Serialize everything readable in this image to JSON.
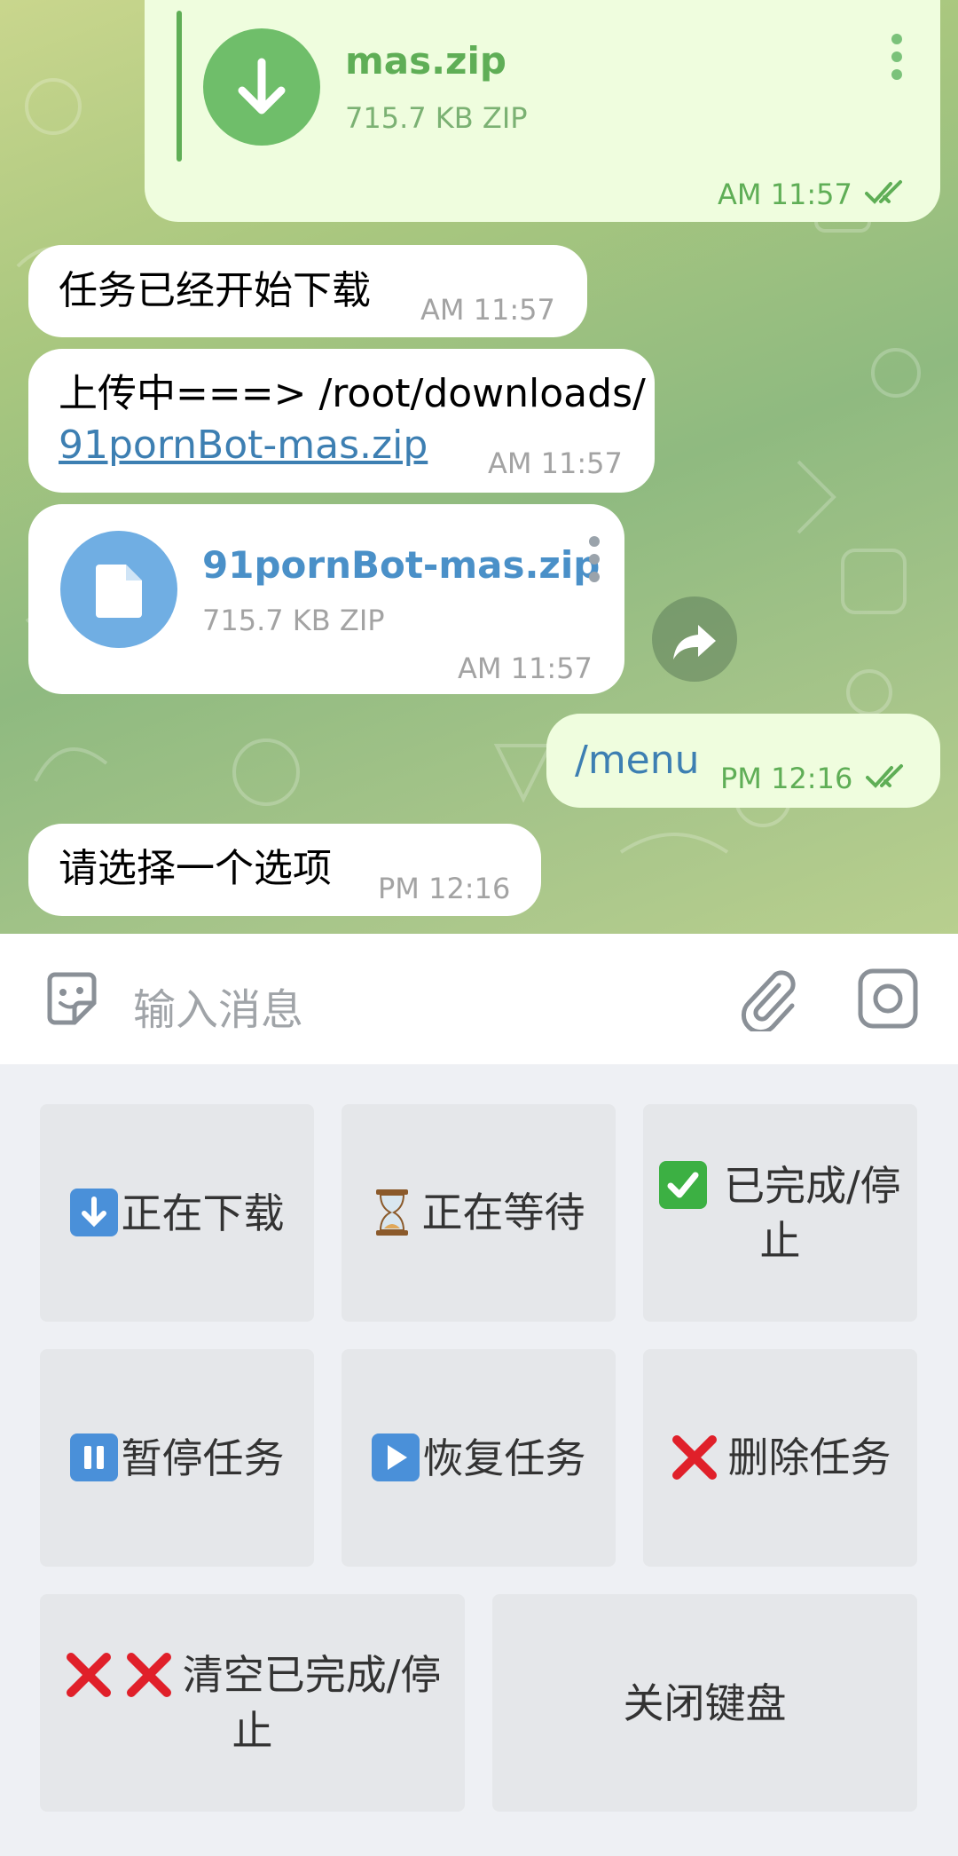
{
  "messages": [
    {
      "file_name": "mas.zip",
      "file_size": "715.7 KB ZIP",
      "time": "AM 11:57"
    },
    {
      "text": "任务已经开始下载",
      "time": "AM 11:57"
    },
    {
      "text_line1": "上传中===> /root/downloads/",
      "link": "91pornBot-mas.zip",
      "time": "AM 11:57"
    },
    {
      "file_name": "91pornBot-mas.zip",
      "file_size": "715.7 KB ZIP",
      "time": "AM 11:57"
    },
    {
      "text": "/menu",
      "time": "PM 12:16"
    },
    {
      "text": "请选择一个选项",
      "time": "PM 12:16"
    }
  ],
  "input": {
    "placeholder": "输入消息"
  },
  "keyboard": {
    "row1": [
      "正在下载",
      "正在等待",
      "已完成/停止"
    ],
    "row2": [
      "暂停任务",
      "恢复任务",
      "删除任务"
    ],
    "row3": [
      "清空已完成/停止",
      "关闭键盘"
    ]
  },
  "colors": {
    "accent_blue": "#3d7fb2",
    "outgoing_bg": "#effdde",
    "file_green": "#6fbe6a",
    "file_blue": "#70aee3"
  }
}
